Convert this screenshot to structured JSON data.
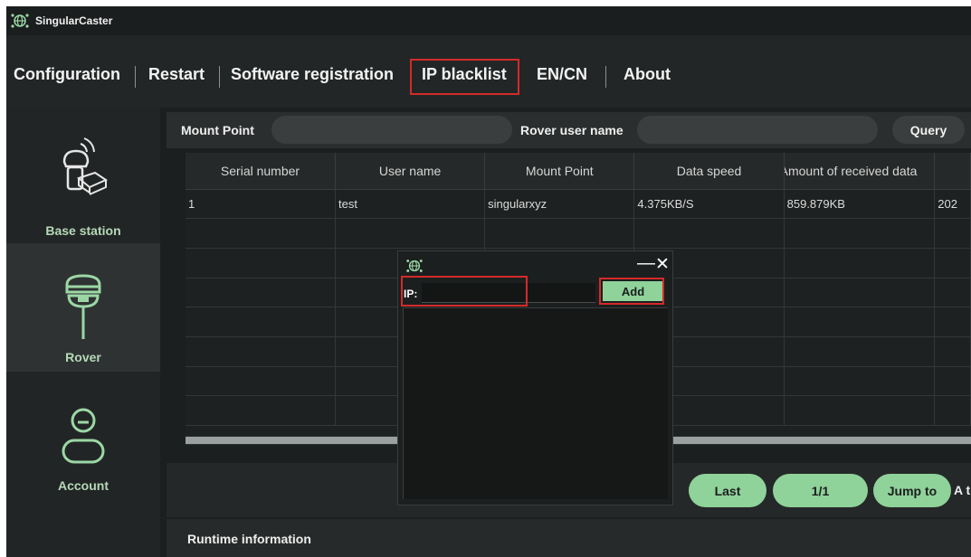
{
  "app": {
    "title": "SingularCaster"
  },
  "menu": {
    "items": [
      "Configuration",
      "Restart",
      "Software registration",
      "IP blacklist",
      "EN/CN",
      "About"
    ],
    "highlighted": "IP blacklist"
  },
  "sidebar": {
    "items": [
      {
        "label": "Base station",
        "icon": "base-station-icon"
      },
      {
        "label": "Rover",
        "icon": "rover-icon",
        "active": true
      },
      {
        "label": "Account",
        "icon": "account-icon"
      }
    ]
  },
  "query": {
    "mount_point_label": "Mount Point",
    "mount_point_value": "",
    "rover_user_label": "Rover user name",
    "rover_user_value": "",
    "query_button": "Query"
  },
  "table": {
    "columns": [
      "Serial number",
      "User name",
      "Mount Point",
      "Data speed",
      "Amount of received data",
      ""
    ],
    "rows": [
      [
        "1",
        "test",
        "singularxyz",
        "4.375KB/S",
        "859.879KB",
        "202"
      ]
    ]
  },
  "pager": {
    "last_label": "Last",
    "page_label": "1/1",
    "jump_label": "Jump to",
    "trailing_text": "A t"
  },
  "runtime": {
    "title": "Runtime information"
  },
  "dialog": {
    "ip_label": "IP:",
    "ip_value": "",
    "add_label": "Add",
    "minimize": "—",
    "close": "✕"
  },
  "colors": {
    "accent": "#8fd29a",
    "highlight": "#d42a2a",
    "background": "#1e2121"
  }
}
